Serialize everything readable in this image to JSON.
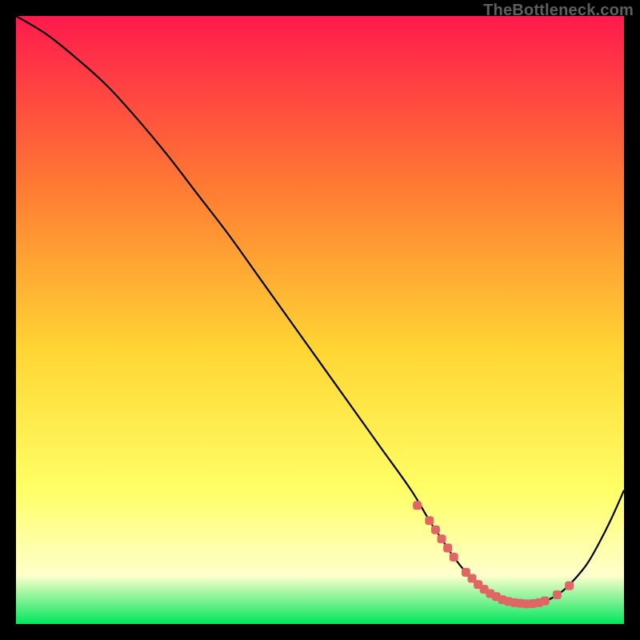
{
  "watermark": "TheBottleneck.com",
  "colors": {
    "background": "#000000",
    "curve_stroke": "#000000",
    "marker_stroke": "#e06666",
    "marker_fill": "#e06666",
    "gradient_top": "#ff1a4d",
    "gradient_mid_upper": "#ff7a33",
    "gradient_mid": "#ffd633",
    "gradient_mid_lower": "#ffff66",
    "gradient_light": "#ffffcc",
    "gradient_bottom": "#00e65c"
  },
  "chart_data": {
    "type": "line",
    "title": "",
    "xlabel": "",
    "ylabel": "",
    "xlim": [
      0,
      100
    ],
    "ylim": [
      0,
      100
    ],
    "series": [
      {
        "name": "curve",
        "x": [
          0,
          5,
          10,
          15,
          20,
          25,
          30,
          35,
          40,
          45,
          50,
          55,
          60,
          65,
          68,
          70,
          72,
          74,
          76,
          78,
          80,
          82,
          84,
          86,
          88,
          90,
          92,
          94,
          96,
          98,
          100
        ],
        "values": [
          100,
          97,
          93,
          88.5,
          83,
          77,
          70.5,
          64,
          57,
          50,
          43,
          36,
          29,
          22,
          17,
          14,
          11,
          8.5,
          6.5,
          5,
          4,
          3.5,
          3.3,
          3.5,
          4.2,
          5.5,
          7.5,
          10,
          13.5,
          17.5,
          22
        ]
      },
      {
        "name": "markers",
        "x": [
          66,
          68,
          69,
          70,
          71,
          72,
          74,
          75,
          76,
          77,
          78,
          79,
          80,
          81,
          82,
          83,
          84,
          85,
          86,
          87,
          89,
          91
        ],
        "values": [
          19.5,
          17,
          15.5,
          14,
          12.5,
          11,
          8.5,
          7.5,
          6.5,
          5.7,
          5,
          4.5,
          4,
          3.7,
          3.5,
          3.4,
          3.3,
          3.35,
          3.5,
          3.8,
          4.8,
          6.3
        ]
      }
    ]
  }
}
